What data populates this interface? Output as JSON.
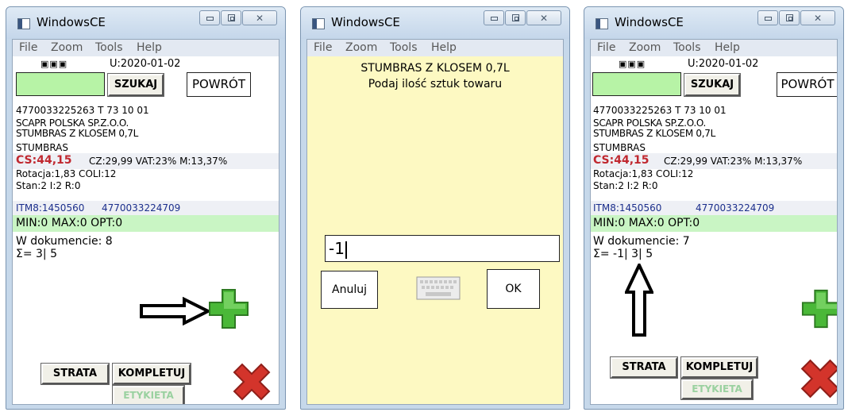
{
  "windows": [
    {
      "title": "WindowsCE",
      "menu": [
        "File",
        "Zoom",
        "Tools",
        "Help"
      ],
      "barcode_glyph": "▣▣▣",
      "date": "U:2020-01-02",
      "search_label": "SZUKAJ",
      "back_label": "POWRÓT",
      "ean_line": "4770033225263  T  73 10 01",
      "supplier": "SCAPR POLSKA SP.Z.O.O.",
      "product": "STUMBRAS Z KLOSEM 0,7L",
      "brand": "STUMBRAS",
      "cs": "CS:44,15",
      "prices": "CZ:29,99 VAT:23% M:13,37%",
      "rotation": "Rotacja:1,83  COLI:12",
      "stock": "Stan:2  I:2  R:0",
      "itm": "ITM8:1450560",
      "itm_ean": "4770033224709",
      "minmax": "MIN:0 MAX:0 OPT:0",
      "in_doc": "W dokumencie: 8",
      "sigma": "Σ= 3| 5",
      "strata_label": "STRATA",
      "kompletuj_label": "KOMPLETUJ",
      "etykieta_label": "ETYKIETA"
    },
    {
      "title": "WindowsCE",
      "menu": [
        "File",
        "Zoom",
        "Tools",
        "Help"
      ],
      "dialog_title": "STUMBRAS Z KLOSEM 0,7L",
      "dialog_prompt": "Podaj ilość sztuk towaru",
      "qty_value": "-1",
      "cancel_label": "Anuluj",
      "ok_label": "OK"
    },
    {
      "title": "WindowsCE",
      "menu": [
        "File",
        "Zoom",
        "Tools",
        "Help"
      ],
      "barcode_glyph": "▣▣▣",
      "date": "U:2020-01-02",
      "search_label": "SZUKAJ",
      "back_label": "POWRÓT",
      "ean_line": "4770033225263  T  73 10 01",
      "supplier": "SCAPR POLSKA SP.Z.O.O.",
      "product": "STUMBRAS Z KLOSEM 0,7L",
      "brand": "STUMBRAS",
      "cs": "CS:44,15",
      "prices": "CZ:29,99 VAT:23% M:13,37%",
      "rotation": "Rotacja:1,83  COLI:12",
      "stock": "Stan:2  I:2  R:0",
      "itm": "ITM8:1450560",
      "itm_ean": "4770033224709",
      "minmax": "MIN:0 MAX:0 OPT:0",
      "in_doc": "W dokumencie: 7",
      "sigma": "Σ= -1| 3| 5",
      "strata_label": "STRATA",
      "kompletuj_label": "KOMPLETUJ",
      "etykieta_label": "ETYKIETA"
    }
  ],
  "colors": {
    "frame": "#c6d8ea",
    "input_green": "#b7f3a6",
    "minmax_band": "#c9f5c4",
    "cs_red": "#c0282f",
    "itm_blue": "#1c2f8c",
    "dialog_yellow": "#fdf9c2",
    "plus_green": "#4ab838",
    "x_red": "#d3342b"
  },
  "icons": [
    "app-icon",
    "minimize-icon",
    "maximize-icon",
    "close-icon",
    "barcode-icon",
    "add-icon",
    "delete-icon",
    "keyboard-icon",
    "arrow-right-icon",
    "arrow-up-icon"
  ]
}
